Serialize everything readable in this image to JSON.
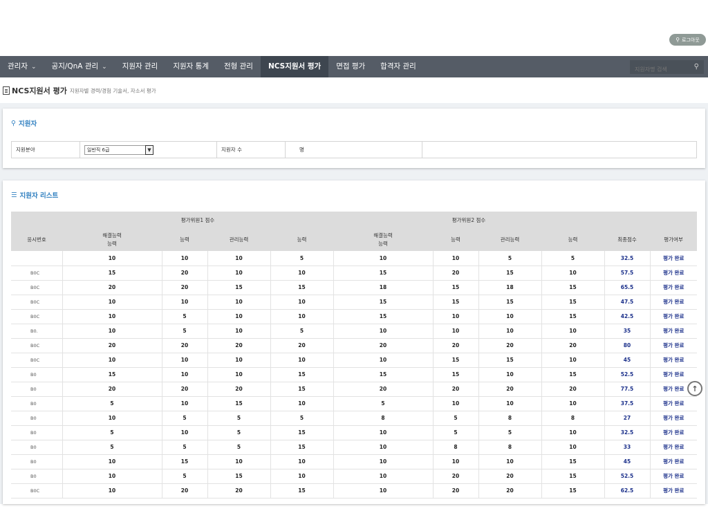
{
  "header": {
    "logout_label": "로그아웃"
  },
  "nav": {
    "items": [
      {
        "label": "관리자",
        "chevron": true
      },
      {
        "label": "공지/QnA 관리",
        "chevron": true
      },
      {
        "label": "지원자 관리",
        "chevron": false
      },
      {
        "label": "지원자 통계",
        "chevron": false
      },
      {
        "label": "전형 관리",
        "chevron": false
      },
      {
        "label": "NCS지원서 평가",
        "chevron": false,
        "active": true
      },
      {
        "label": "면접 평가",
        "chevron": false
      },
      {
        "label": "합격자 관리",
        "chevron": false
      }
    ],
    "search_placeholder": "지원자명 검색"
  },
  "page": {
    "title": "NCS지원서 평가",
    "subtitle": "지원자별 경력/경험 기술서, 자소서 평가"
  },
  "applicant_panel": {
    "heading": "지원자",
    "field_label": "지원분야",
    "field_value": "일반직 6급",
    "count_label": "지원자 수",
    "count_unit": "명"
  },
  "list_panel": {
    "heading": "지원자 리스트",
    "group_headers": [
      "평가위원1 점수",
      "평가위원2 점수"
    ],
    "columns": [
      "응시번호",
      "해결능력\n능력",
      "능력",
      "관리능력",
      "능력",
      "해결능력\n능력",
      "능력",
      "관리능력",
      "능력",
      "최종점수",
      "평가여부"
    ],
    "rows": [
      {
        "id": "",
        "c1": "10",
        "c2": "10",
        "c3": "10",
        "c4": "5",
        "c5": "10",
        "c6": "10",
        "c7": "5",
        "c8": "5",
        "score": "32.5",
        "status": "평가 완료"
      },
      {
        "id": "B0C",
        "c1": "15",
        "c2": "20",
        "c3": "10",
        "c4": "10",
        "c5": "15",
        "c6": "20",
        "c7": "15",
        "c8": "10",
        "score": "57.5",
        "status": "평가 완료"
      },
      {
        "id": "B0C",
        "c1": "20",
        "c2": "20",
        "c3": "15",
        "c4": "15",
        "c5": "18",
        "c6": "15",
        "c7": "18",
        "c8": "15",
        "score": "65.5",
        "status": "평가 완료"
      },
      {
        "id": "B0C",
        "c1": "10",
        "c2": "10",
        "c3": "10",
        "c4": "10",
        "c5": "15",
        "c6": "15",
        "c7": "15",
        "c8": "15",
        "score": "47.5",
        "status": "평가 완료"
      },
      {
        "id": "B0C",
        "c1": "10",
        "c2": "5",
        "c3": "10",
        "c4": "10",
        "c5": "15",
        "c6": "10",
        "c7": "10",
        "c8": "15",
        "score": "42.5",
        "status": "평가 완료"
      },
      {
        "id": "B0.",
        "c1": "10",
        "c2": "5",
        "c3": "10",
        "c4": "5",
        "c5": "10",
        "c6": "10",
        "c7": "10",
        "c8": "10",
        "score": "35",
        "status": "평가 완료"
      },
      {
        "id": "B0C",
        "c1": "20",
        "c2": "20",
        "c3": "20",
        "c4": "20",
        "c5": "20",
        "c6": "20",
        "c7": "20",
        "c8": "20",
        "score": "80",
        "status": "평가 완료"
      },
      {
        "id": "B0C",
        "c1": "10",
        "c2": "10",
        "c3": "10",
        "c4": "10",
        "c5": "10",
        "c6": "15",
        "c7": "15",
        "c8": "10",
        "score": "45",
        "status": "평가 완료"
      },
      {
        "id": "B0",
        "c1": "15",
        "c2": "10",
        "c3": "10",
        "c4": "15",
        "c5": "15",
        "c6": "15",
        "c7": "10",
        "c8": "15",
        "score": "52.5",
        "status": "평가 완료"
      },
      {
        "id": "B0",
        "c1": "20",
        "c2": "20",
        "c3": "20",
        "c4": "15",
        "c5": "20",
        "c6": "20",
        "c7": "20",
        "c8": "20",
        "score": "77.5",
        "status": "평가 완료"
      },
      {
        "id": "B0",
        "c1": "5",
        "c2": "10",
        "c3": "15",
        "c4": "10",
        "c5": "5",
        "c6": "10",
        "c7": "10",
        "c8": "10",
        "score": "37.5",
        "status": "평가 완료"
      },
      {
        "id": "B0",
        "c1": "10",
        "c2": "5",
        "c3": "5",
        "c4": "5",
        "c5": "8",
        "c6": "5",
        "c7": "8",
        "c8": "8",
        "score": "27",
        "status": "평가 완료"
      },
      {
        "id": "B0",
        "c1": "5",
        "c2": "10",
        "c3": "5",
        "c4": "15",
        "c5": "10",
        "c6": "5",
        "c7": "5",
        "c8": "10",
        "score": "32.5",
        "status": "평가 완료"
      },
      {
        "id": "B0",
        "c1": "5",
        "c2": "5",
        "c3": "5",
        "c4": "15",
        "c5": "10",
        "c6": "8",
        "c7": "8",
        "c8": "10",
        "score": "33",
        "status": "평가 완료"
      },
      {
        "id": "B0",
        "c1": "10",
        "c2": "15",
        "c3": "10",
        "c4": "10",
        "c5": "10",
        "c6": "10",
        "c7": "10",
        "c8": "15",
        "score": "45",
        "status": "평가 완료"
      },
      {
        "id": "B0",
        "c1": "10",
        "c2": "5",
        "c3": "15",
        "c4": "10",
        "c5": "10",
        "c6": "20",
        "c7": "20",
        "c8": "15",
        "score": "52.5",
        "status": "평가 완료"
      },
      {
        "id": "B0C",
        "c1": "10",
        "c2": "20",
        "c3": "20",
        "c4": "15",
        "c5": "10",
        "c6": "20",
        "c7": "20",
        "c8": "15",
        "score": "62.5",
        "status": "평가 완료"
      }
    ]
  },
  "colors": {
    "nav_bg": "#555c66",
    "nav_active_bg": "#3e4650",
    "accent_blue": "#2f7fc0",
    "score_blue": "#1a2f8a",
    "header_gray": "#dcdcdc"
  }
}
